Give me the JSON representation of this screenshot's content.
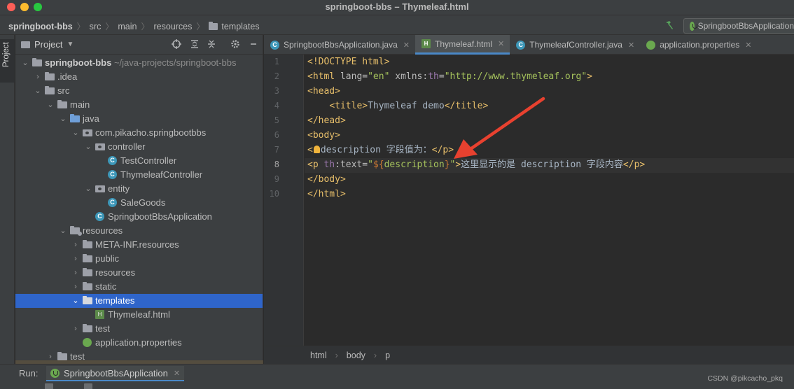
{
  "window": {
    "title": "springboot-bbs – Thymeleaf.html"
  },
  "breadcrumb": [
    "springboot-bbs",
    "src",
    "main",
    "resources",
    "templates"
  ],
  "run_config": {
    "label": "SpringbootBbsApplication"
  },
  "side_strip": {
    "project_tab": "Project"
  },
  "project_panel": {
    "title": "Project",
    "tree": [
      {
        "label": "springboot-bbs",
        "extra": "~/java-projects/springboot-bbs"
      },
      {
        "label": ".idea"
      },
      {
        "label": "src"
      },
      {
        "label": "main"
      },
      {
        "label": "java"
      },
      {
        "label": "com.pikacho.springbootbbs"
      },
      {
        "label": "controller"
      },
      {
        "label": "TestController"
      },
      {
        "label": "ThymeleafController"
      },
      {
        "label": "entity"
      },
      {
        "label": "SaleGoods"
      },
      {
        "label": "SpringbootBbsApplication"
      },
      {
        "label": "resources"
      },
      {
        "label": "META-INF.resources"
      },
      {
        "label": "public"
      },
      {
        "label": "resources"
      },
      {
        "label": "static"
      },
      {
        "label": "templates"
      },
      {
        "label": "Thymeleaf.html"
      },
      {
        "label": "test"
      },
      {
        "label": "application.properties"
      },
      {
        "label": "test"
      }
    ]
  },
  "editor_tabs": [
    {
      "label": "SpringbootBbsApplication.java"
    },
    {
      "label": "Thymeleaf.html"
    },
    {
      "label": "ThymeleafController.java"
    },
    {
      "label": "application.properties"
    }
  ],
  "code": {
    "line_numbers": [
      "1",
      "2",
      "3",
      "4",
      "5",
      "6",
      "7",
      "8",
      "9",
      "10"
    ],
    "l1_tag": "<!DOCTYPE html>",
    "l2_open": "<html ",
    "l2_attr1": "lang=",
    "l2_val1": "\"en\"",
    "l2_ns": " xmlns:",
    "l2_th": "th",
    "l2_eq": "=",
    "l2_val2": "\"http://www.thymeleaf.org\"",
    "l2_close": ">",
    "l3_tag": "<head>",
    "l4_indent": "    ",
    "l4_open": "<title>",
    "l4_text": "Thymeleaf demo",
    "l4_close": "</title>",
    "l5_tag": "</head>",
    "l6_tag": "<body>",
    "l7_open_a": "<",
    "l7_text": "description 字段值为：",
    "l7_close": "</p>",
    "l8_open": "<p ",
    "l8_th": "th",
    "l8_attr": ":text=",
    "l8_q1": "\"",
    "l8_expr": "${",
    "l8_var": "description",
    "l8_expr_end": "}",
    "l8_q2": "\"",
    "l8_gt": ">",
    "l8_text": "这里显示的是 description 字段内容",
    "l8_close": "</p>",
    "l9_tag": "</body>",
    "l10_tag": "</html>"
  },
  "editor_breadcrumb": [
    "html",
    "body",
    "p"
  ],
  "run_bar": {
    "label": "Run:",
    "tab": "SpringbootBbsApplication",
    "watermark": "CSDN @pikcacho_pkq"
  },
  "colors": {
    "arrow": "#e8412f",
    "selection": "#2f65ca",
    "tag": "#e8bf6a",
    "string": "#a5c25c"
  }
}
